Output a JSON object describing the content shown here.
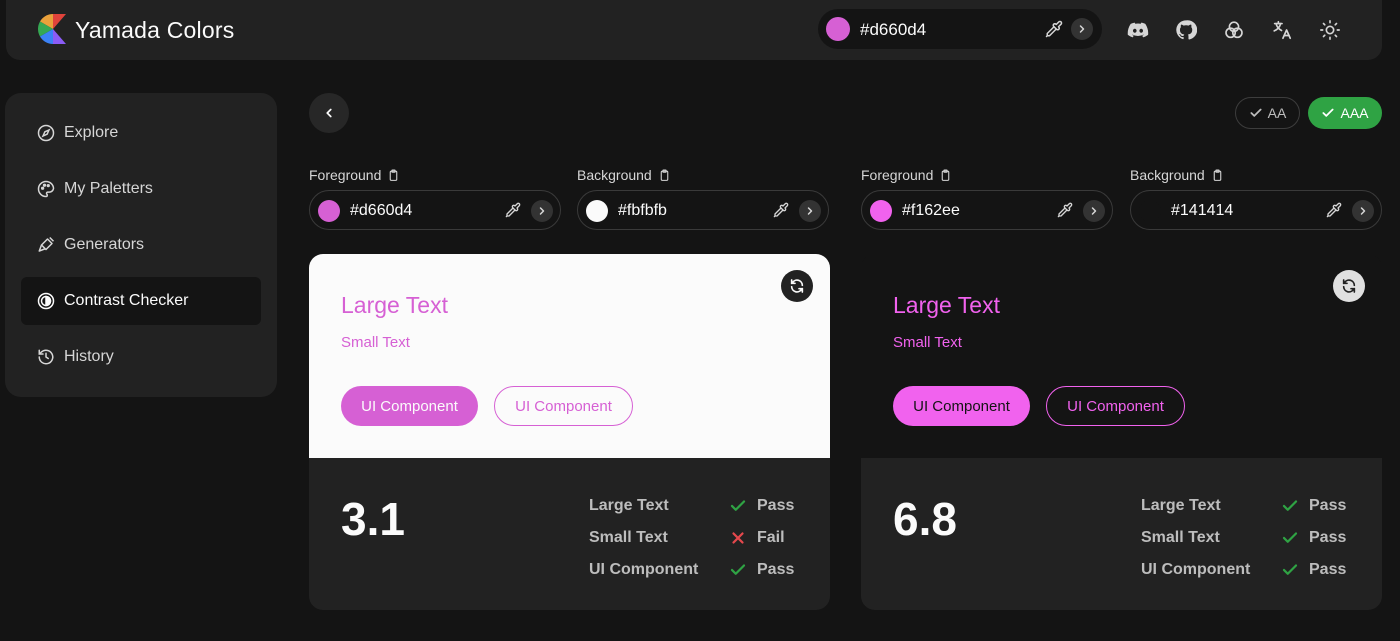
{
  "app": {
    "title": "Yamada Colors"
  },
  "header": {
    "current_color": "#d660d4",
    "icons": [
      "discord-icon",
      "github-icon",
      "color-mode-icon",
      "language-icon",
      "theme-sun-icon"
    ]
  },
  "sidebar": {
    "items": [
      {
        "label": "Explore",
        "icon": "compass-icon",
        "active": false
      },
      {
        "label": "My Paletters",
        "icon": "palette-icon",
        "active": false
      },
      {
        "label": "Generators",
        "icon": "brush-icon",
        "active": false
      },
      {
        "label": "Contrast Checker",
        "icon": "contrast-icon",
        "active": true
      },
      {
        "label": "History",
        "icon": "history-icon",
        "active": false
      }
    ]
  },
  "levels": {
    "aa": "AA",
    "aaa": "AAA",
    "selected": "AAA"
  },
  "colors": {
    "pass": "#2fa344",
    "fail": "#e5484d",
    "accent": "#d660d4"
  },
  "panels": [
    {
      "foreground_label": "Foreground",
      "background_label": "Background",
      "foreground": "#d660d4",
      "background": "#fbfbfb",
      "large_text": "Large Text",
      "small_text": "Small Text",
      "ui_solid": "UI Component",
      "ui_outline": "UI Component",
      "ratio": "3.1",
      "results": [
        {
          "label": "Large Text",
          "status": "Pass"
        },
        {
          "label": "Small Text",
          "status": "Fail"
        },
        {
          "label": "UI Component",
          "status": "Pass"
        }
      ]
    },
    {
      "foreground_label": "Foreground",
      "background_label": "Background",
      "foreground": "#f162ee",
      "background": "#141414",
      "large_text": "Large Text",
      "small_text": "Small Text",
      "ui_solid": "UI Component",
      "ui_outline": "UI Component",
      "ratio": "6.8",
      "results": [
        {
          "label": "Large Text",
          "status": "Pass"
        },
        {
          "label": "Small Text",
          "status": "Pass"
        },
        {
          "label": "UI Component",
          "status": "Pass"
        }
      ]
    }
  ]
}
